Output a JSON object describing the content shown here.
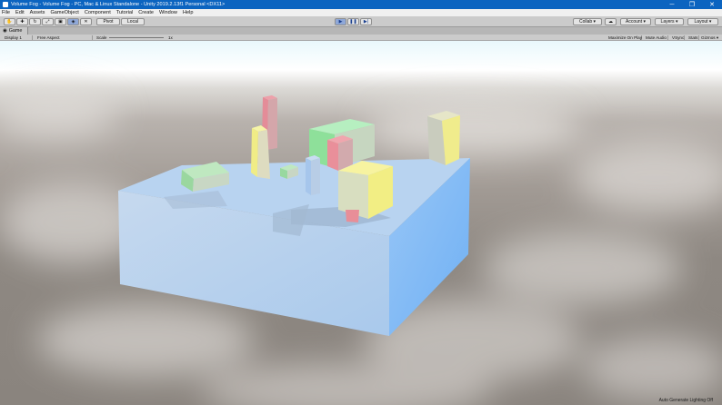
{
  "window": {
    "title": "Volume Fog - Volume Fog - PC, Mac & Linux Standalone - Unity 2019.2.13f1 Personal <DX11>",
    "buttons": [
      "─",
      "❐",
      "✕"
    ]
  },
  "menu": [
    "File",
    "Edit",
    "Assets",
    "GameObject",
    "Component",
    "Tutorial",
    "Create",
    "Window",
    "Help"
  ],
  "toolbar": {
    "tools": [
      "hand-tool",
      "move-tool",
      "rotate-tool",
      "scale-tool",
      "rect-tool",
      "transform-tool",
      "custom-tool"
    ],
    "pivot": "Pivot",
    "local": "Local",
    "play": "▶",
    "pause": "❚❚",
    "step": "▶|",
    "collab": "Collab ▾",
    "cloud": "☁",
    "account": "Account ▾",
    "layers": "Layers ▾",
    "layout": "Layout ▾"
  },
  "game_tab": {
    "label": "Game"
  },
  "game_options": {
    "display": "Display 1",
    "aspect": "Free Aspect",
    "scale_label": "Scale",
    "scale_value": "1x",
    "maximize": "Maximize On Play",
    "mute": "Mute Audio",
    "vsync": "VSync",
    "stats": "Stats",
    "gizmos": "Gizmos ▾"
  },
  "status_bar": {
    "lighting": "Auto Generate Lighting Off"
  },
  "colors": {
    "titlebar": "#0b64c0",
    "platform": "#b4d4f4",
    "block_green": "#8fe099",
    "block_red": "#e8a0a8",
    "block_yellow": "#f2f08a"
  }
}
